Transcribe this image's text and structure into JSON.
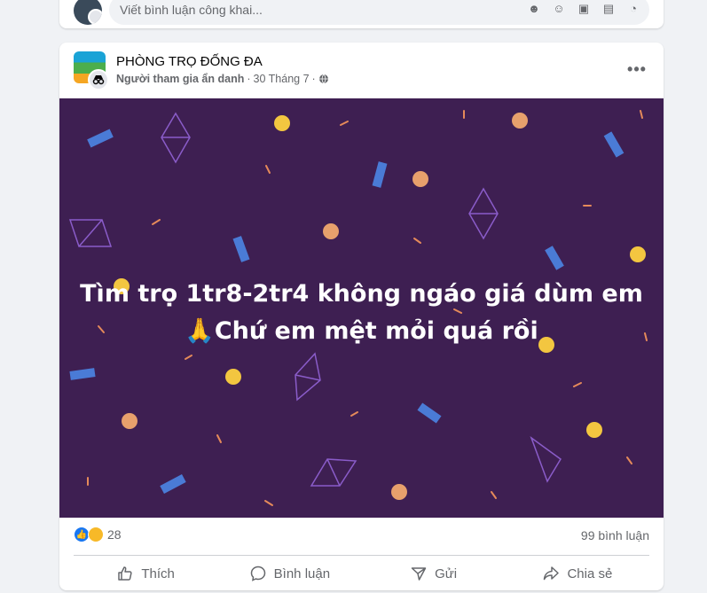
{
  "comment_bar": {
    "placeholder": "Viết bình luận công khai...",
    "icons": [
      "avatar-sticker-icon",
      "emoji-icon",
      "camera-icon",
      "gif-icon",
      "sticker-icon"
    ]
  },
  "post": {
    "group_name": "PHÒNG TRỌ ĐỐNG ĐA",
    "author": "Người tham gia ẩn danh",
    "separator": "·",
    "date": "30 Tháng 7",
    "separator2": "·",
    "privacy_icon": "globe-icon",
    "more_label": "•••",
    "text_line1": "Tìm trọ 1tr8-2tr4 không ngáo giá dùm em",
    "text_line2": "🙏Chứ em mệt mỏi quá rồi",
    "background_color": "#3e1f52"
  },
  "stats": {
    "reaction_count": "28",
    "comment_count": "99 bình luận"
  },
  "actions": {
    "like": "Thích",
    "comment": "Bình luận",
    "send": "Gửi",
    "share": "Chia sẻ"
  },
  "colors": {
    "accent": "#1877f2",
    "secondary_text": "#65676b"
  }
}
